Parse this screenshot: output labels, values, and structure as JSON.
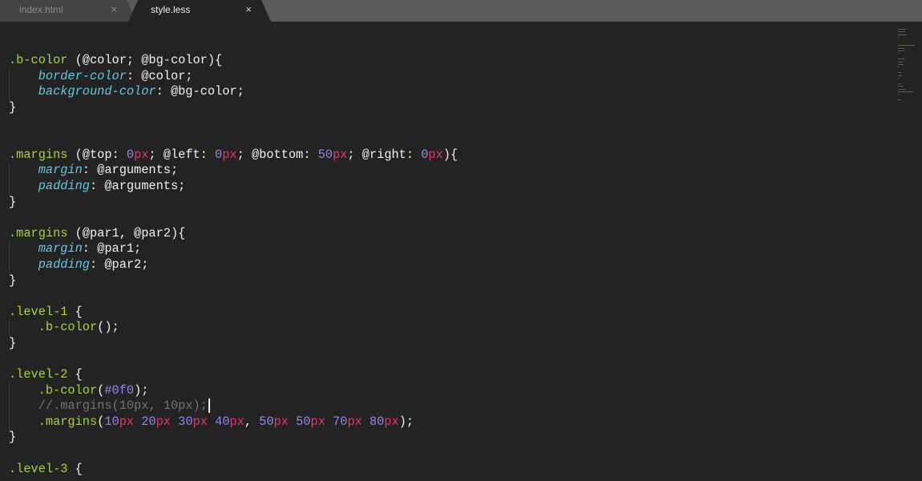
{
  "tabs": [
    {
      "label": "index.html",
      "close": "×",
      "active": false
    },
    {
      "label": "style.less",
      "close": "×",
      "active": true
    }
  ],
  "code": {
    "lines": [
      [],
      [],
      [
        [
          "sel",
          ".b-color"
        ],
        [
          "txt",
          " (@color; @bg-color){"
        ]
      ],
      [
        [
          "txt",
          "    "
        ],
        [
          "prop",
          "border-color"
        ],
        [
          "txt",
          ": @color;"
        ]
      ],
      [
        [
          "txt",
          "    "
        ],
        [
          "prop",
          "background-color"
        ],
        [
          "txt",
          ": @bg-color;"
        ]
      ],
      [
        [
          "txt",
          "}"
        ]
      ],
      [],
      [],
      [
        [
          "sel",
          ".margins"
        ],
        [
          "txt",
          " (@top: "
        ],
        [
          "num",
          "0"
        ],
        [
          "unit",
          "px"
        ],
        [
          "txt",
          "; @left: "
        ],
        [
          "num",
          "0"
        ],
        [
          "unit",
          "px"
        ],
        [
          "txt",
          "; @bottom: "
        ],
        [
          "num",
          "50"
        ],
        [
          "unit",
          "px"
        ],
        [
          "txt",
          "; @right: "
        ],
        [
          "num",
          "0"
        ],
        [
          "unit",
          "px"
        ],
        [
          "txt",
          "){"
        ]
      ],
      [
        [
          "txt",
          "    "
        ],
        [
          "prop",
          "margin"
        ],
        [
          "txt",
          ": @arguments;"
        ]
      ],
      [
        [
          "txt",
          "    "
        ],
        [
          "prop",
          "padding"
        ],
        [
          "txt",
          ": @arguments;"
        ]
      ],
      [
        [
          "txt",
          "}"
        ]
      ],
      [],
      [
        [
          "sel",
          ".margins"
        ],
        [
          "txt",
          " (@par1, @par2){"
        ]
      ],
      [
        [
          "txt",
          "    "
        ],
        [
          "prop",
          "margin"
        ],
        [
          "txt",
          ": @par1;"
        ]
      ],
      [
        [
          "txt",
          "    "
        ],
        [
          "prop",
          "padding"
        ],
        [
          "txt",
          ": @par2;"
        ]
      ],
      [
        [
          "txt",
          "}"
        ]
      ],
      [],
      [
        [
          "sel",
          ".level-1"
        ],
        [
          "txt",
          " {"
        ]
      ],
      [
        [
          "txt",
          "    "
        ],
        [
          "sel",
          ".b-color"
        ],
        [
          "txt",
          "();"
        ]
      ],
      [
        [
          "txt",
          "}"
        ]
      ],
      [],
      [
        [
          "sel",
          ".level-2"
        ],
        [
          "txt",
          " {"
        ]
      ],
      [
        [
          "txt",
          "    "
        ],
        [
          "sel",
          ".b-color"
        ],
        [
          "txt",
          "("
        ],
        [
          "num",
          "#0f0"
        ],
        [
          "txt",
          ");"
        ]
      ],
      [
        [
          "txt",
          "    "
        ],
        [
          "com",
          "//.margins(10px, 10px);"
        ]
      ],
      [
        [
          "txt",
          "    "
        ],
        [
          "sel",
          ".margins"
        ],
        [
          "txt",
          "("
        ],
        [
          "num",
          "10"
        ],
        [
          "unit",
          "px"
        ],
        [
          "txt",
          " "
        ],
        [
          "num",
          "20"
        ],
        [
          "unit",
          "px"
        ],
        [
          "txt",
          " "
        ],
        [
          "num",
          "30"
        ],
        [
          "unit",
          "px"
        ],
        [
          "txt",
          " "
        ],
        [
          "num",
          "40"
        ],
        [
          "unit",
          "px"
        ],
        [
          "txt",
          ", "
        ],
        [
          "num",
          "50"
        ],
        [
          "unit",
          "px"
        ],
        [
          "txt",
          " "
        ],
        [
          "num",
          "50"
        ],
        [
          "unit",
          "px"
        ],
        [
          "txt",
          " "
        ],
        [
          "num",
          "70"
        ],
        [
          "unit",
          "px"
        ],
        [
          "txt",
          " "
        ],
        [
          "num",
          "80"
        ],
        [
          "unit",
          "px"
        ],
        [
          "txt",
          ");"
        ]
      ],
      [
        [
          "txt",
          "}"
        ]
      ],
      [],
      [
        [
          "sel",
          ".level-3"
        ],
        [
          "txt",
          " {"
        ]
      ]
    ]
  }
}
